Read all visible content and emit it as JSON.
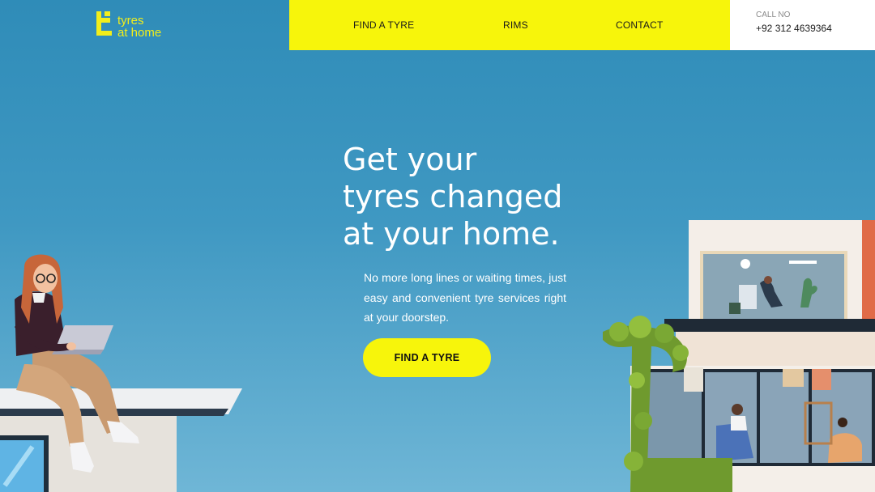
{
  "brand": {
    "name_line1": "tyres",
    "name_line2": "at home",
    "color": "#f2ee1b"
  },
  "nav": {
    "items": [
      {
        "label": "FIND A TYRE"
      },
      {
        "label": "RIMS"
      },
      {
        "label": "CONTACT"
      }
    ],
    "background": "#f7f50b"
  },
  "contact": {
    "label": "CALL NO",
    "phone": "+92 312 4639364"
  },
  "hero": {
    "title_lines": [
      "Get your",
      "tyres changed",
      "at your home."
    ],
    "subtitle": "No more long lines or waiting times, just easy and convenient tyre services right at your doorstep.",
    "cta_label": "FIND A TYRE"
  },
  "illustrations": {
    "left": "woman-with-laptop-on-rooftop",
    "right": "modern-house-with-people-inside"
  }
}
